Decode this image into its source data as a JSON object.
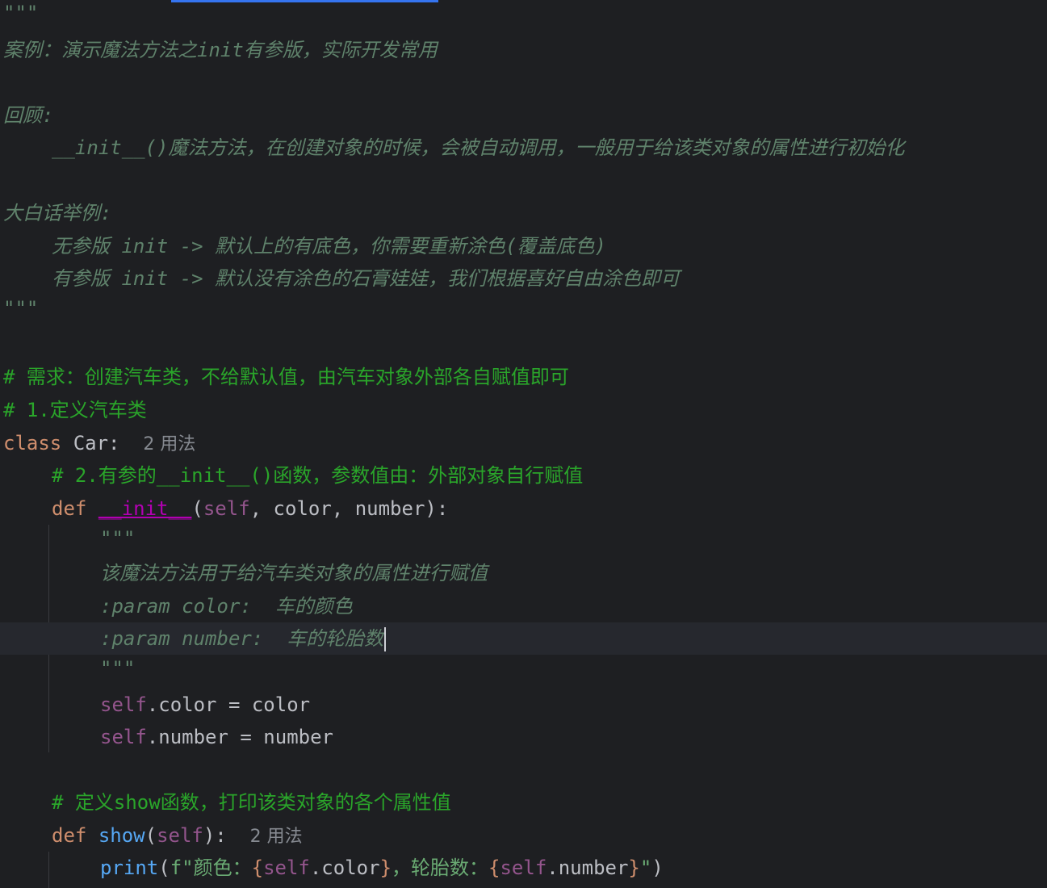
{
  "docstring_module": {
    "quote": "\"\"\"",
    "title": "案例：演示魔法方法之init有参版，实际开发常用",
    "review_label": "回顾:",
    "review_text": "__init__()魔法方法，在创建对象的时候，会被自动调用，一般用于给该类对象的属性进行初始化",
    "example_label": "大白话举例:",
    "example_1": "无参版 init -> 默认上的有底色，你需要重新涂色(覆盖底色)",
    "example_2": "有参版 init -> 默认没有涂色的石膏娃娃，我们根据喜好自由涂色即可"
  },
  "comments": {
    "requirement": "# 需求：创建汽车类，不给默认值，由汽车对象外部各自赋值即可",
    "step1": "# 1.定义汽车类",
    "step2_prefix": "# 2.有参的",
    "step2_magic": "__init__",
    "step2_suffix": "()函数，参数值由：外部对象自行赋值",
    "show": "# 定义show函数，打印该类对象的各个属性值"
  },
  "class_def": {
    "keyword": "class",
    "name": "Car:",
    "usage_hint": "2 用法"
  },
  "init_def": {
    "keyword": "def",
    "name": "__init__",
    "open": "(",
    "self": "self",
    "params": ", color, number):"
  },
  "init_doc": {
    "quote": "\"\"\"",
    "desc": "该魔法方法用于给汽车类对象的属性进行赋值",
    "param_color": ":param color:  车的颜色",
    "param_number": ":param number:  车的轮胎数"
  },
  "assignments": {
    "self": "self",
    "color": ".color = color",
    "number": ".number = number"
  },
  "show_def": {
    "keyword": "def",
    "name": "show",
    "open": "(",
    "self": "self",
    "close": "):",
    "usage_hint": "2 用法"
  },
  "print_stmt": {
    "func": "print",
    "open": "(",
    "str_start": "f\"颜色：",
    "brace_open_1": "{",
    "self_1": "self",
    "attr_1": ".color",
    "brace_close_1": "}",
    "str_mid": "，轮胎数：",
    "brace_open_2": "{",
    "self_2": "self",
    "attr_2": ".number",
    "brace_close_2": "}",
    "str_end": "\"",
    "close": ")"
  },
  "colors": {
    "background": "#1e1f22",
    "docstring": "#5f826b",
    "comment": "#2aa52a",
    "keyword": "#cf8e6d",
    "self": "#94558d",
    "magic": "#b200b2",
    "function": "#56a8f5"
  }
}
